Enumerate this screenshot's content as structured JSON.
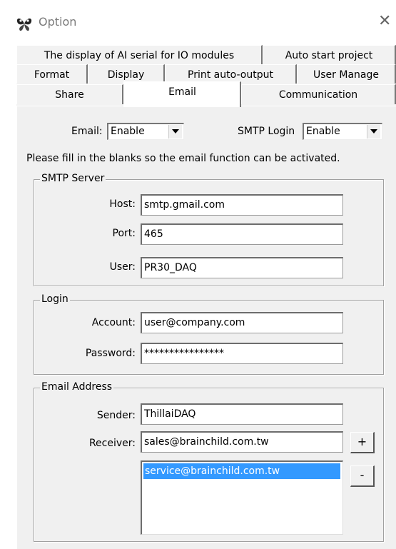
{
  "window": {
    "title": "Option",
    "icon": "butterfly-app-icon",
    "close_icon": "close-icon"
  },
  "tabs": {
    "row1": [
      {
        "label": "The display of AI serial for IO modules"
      },
      {
        "label": "Auto start project"
      }
    ],
    "row2": [
      {
        "label": "Format"
      },
      {
        "label": "Display"
      },
      {
        "label": "Print auto-output"
      },
      {
        "label": "User Manage"
      }
    ],
    "row3": [
      {
        "label": "Share"
      },
      {
        "label": "Email",
        "selected": true
      },
      {
        "label": "Communication"
      }
    ]
  },
  "email_settings": {
    "email_label": "Email:",
    "email_value": "Enable",
    "smtp_login_label": "SMTP Login",
    "smtp_login_value": "Enable",
    "instruction": "Please fill in the blanks so the email function can be activated."
  },
  "smtp_server": {
    "legend": "SMTP Server",
    "host_label": "Host:",
    "host_value": "smtp.gmail.com",
    "port_label": "Port:",
    "port_value": "465",
    "user_label": "User:",
    "user_value": "PR30_DAQ"
  },
  "login": {
    "legend": "Login",
    "account_label": "Account:",
    "account_value": "user@company.com",
    "password_label": "Password:",
    "password_value": "****************"
  },
  "email_address": {
    "legend": "Email Address",
    "sender_label": "Sender:",
    "sender_value": "ThillaiDAQ",
    "receiver_label": "Receiver:",
    "receiver_value": "sales@brainchild.com.tw",
    "add_label": "+",
    "remove_label": "-",
    "receivers_list": [
      "service@brainchild.com.tw"
    ]
  },
  "colors": {
    "selection": "#3399ff",
    "panel": "#f0f0f0"
  }
}
